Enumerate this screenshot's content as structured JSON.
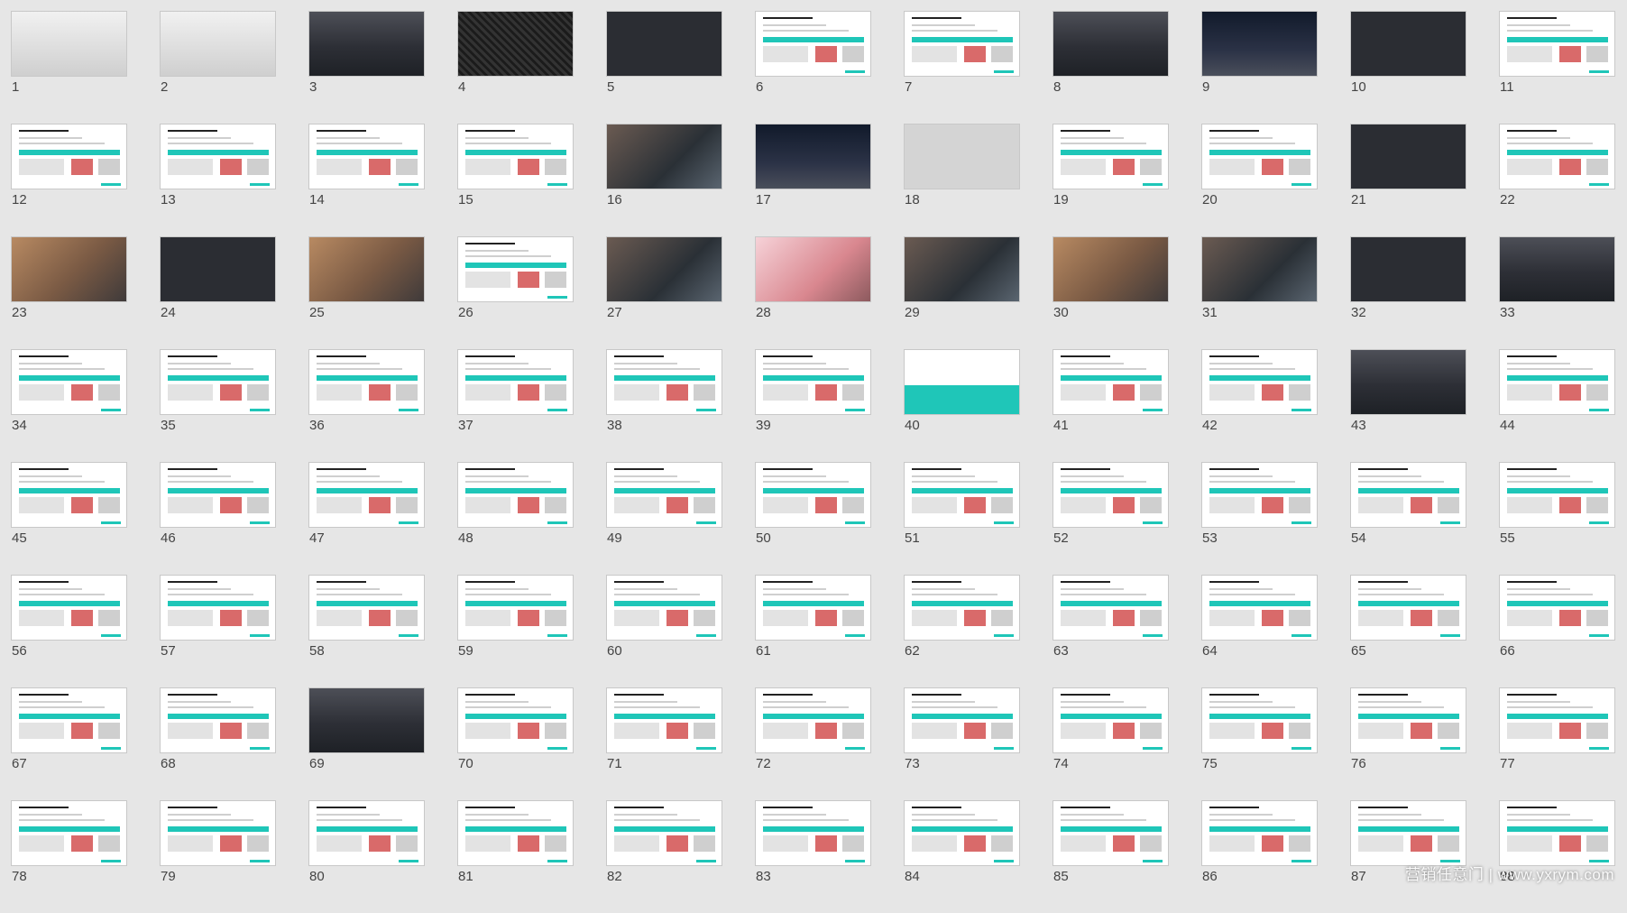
{
  "slides": [
    {
      "number": "1",
      "variant": "v-car"
    },
    {
      "number": "2",
      "variant": "v-car"
    },
    {
      "number": "3",
      "variant": "v-city"
    },
    {
      "number": "4",
      "variant": "v-fabric"
    },
    {
      "number": "5",
      "variant": "v-dark"
    },
    {
      "number": "6",
      "variant": "v-white"
    },
    {
      "number": "7",
      "variant": "v-white"
    },
    {
      "number": "8",
      "variant": "v-city"
    },
    {
      "number": "9",
      "variant": "v-sky"
    },
    {
      "number": "10",
      "variant": "v-dark"
    },
    {
      "number": "11",
      "variant": "v-white"
    },
    {
      "number": "12",
      "variant": "v-white"
    },
    {
      "number": "13",
      "variant": "v-white"
    },
    {
      "number": "14",
      "variant": "v-white"
    },
    {
      "number": "15",
      "variant": "v-white"
    },
    {
      "number": "16",
      "variant": "v-photo"
    },
    {
      "number": "17",
      "variant": "v-sky"
    },
    {
      "number": "18",
      "variant": "v-gray"
    },
    {
      "number": "19",
      "variant": "v-white"
    },
    {
      "number": "20",
      "variant": "v-white"
    },
    {
      "number": "21",
      "variant": "v-dark"
    },
    {
      "number": "22",
      "variant": "v-white"
    },
    {
      "number": "23",
      "variant": "v-warm"
    },
    {
      "number": "24",
      "variant": "v-dark"
    },
    {
      "number": "25",
      "variant": "v-warm"
    },
    {
      "number": "26",
      "variant": "v-white"
    },
    {
      "number": "27",
      "variant": "v-photo"
    },
    {
      "number": "28",
      "variant": "v-pink"
    },
    {
      "number": "29",
      "variant": "v-photo"
    },
    {
      "number": "30",
      "variant": "v-warm"
    },
    {
      "number": "31",
      "variant": "v-photo"
    },
    {
      "number": "32",
      "variant": "v-dark"
    },
    {
      "number": "33",
      "variant": "v-city"
    },
    {
      "number": "34",
      "variant": "v-white"
    },
    {
      "number": "35",
      "variant": "v-white"
    },
    {
      "number": "36",
      "variant": "v-white"
    },
    {
      "number": "37",
      "variant": "v-white"
    },
    {
      "number": "38",
      "variant": "v-white"
    },
    {
      "number": "39",
      "variant": "v-white"
    },
    {
      "number": "40",
      "variant": "v-teal"
    },
    {
      "number": "41",
      "variant": "v-white"
    },
    {
      "number": "42",
      "variant": "v-white"
    },
    {
      "number": "43",
      "variant": "v-city"
    },
    {
      "number": "44",
      "variant": "v-white"
    },
    {
      "number": "45",
      "variant": "v-white"
    },
    {
      "number": "46",
      "variant": "v-white"
    },
    {
      "number": "47",
      "variant": "v-white"
    },
    {
      "number": "48",
      "variant": "v-white"
    },
    {
      "number": "49",
      "variant": "v-white"
    },
    {
      "number": "50",
      "variant": "v-white"
    },
    {
      "number": "51",
      "variant": "v-white"
    },
    {
      "number": "52",
      "variant": "v-white"
    },
    {
      "number": "53",
      "variant": "v-white"
    },
    {
      "number": "54",
      "variant": "v-white"
    },
    {
      "number": "55",
      "variant": "v-white"
    },
    {
      "number": "56",
      "variant": "v-white"
    },
    {
      "number": "57",
      "variant": "v-white"
    },
    {
      "number": "58",
      "variant": "v-white"
    },
    {
      "number": "59",
      "variant": "v-white"
    },
    {
      "number": "60",
      "variant": "v-white"
    },
    {
      "number": "61",
      "variant": "v-white"
    },
    {
      "number": "62",
      "variant": "v-white"
    },
    {
      "number": "63",
      "variant": "v-white"
    },
    {
      "number": "64",
      "variant": "v-white"
    },
    {
      "number": "65",
      "variant": "v-white"
    },
    {
      "number": "66",
      "variant": "v-white"
    },
    {
      "number": "67",
      "variant": "v-white"
    },
    {
      "number": "68",
      "variant": "v-white"
    },
    {
      "number": "69",
      "variant": "v-city"
    },
    {
      "number": "70",
      "variant": "v-white"
    },
    {
      "number": "71",
      "variant": "v-white"
    },
    {
      "number": "72",
      "variant": "v-white"
    },
    {
      "number": "73",
      "variant": "v-white"
    },
    {
      "number": "74",
      "variant": "v-white"
    },
    {
      "number": "75",
      "variant": "v-white"
    },
    {
      "number": "76",
      "variant": "v-white"
    },
    {
      "number": "77",
      "variant": "v-white"
    },
    {
      "number": "78",
      "variant": "v-white"
    },
    {
      "number": "79",
      "variant": "v-white"
    },
    {
      "number": "80",
      "variant": "v-white"
    },
    {
      "number": "81",
      "variant": "v-white"
    },
    {
      "number": "82",
      "variant": "v-white"
    },
    {
      "number": "83",
      "variant": "v-white"
    },
    {
      "number": "84",
      "variant": "v-white"
    },
    {
      "number": "85",
      "variant": "v-white"
    },
    {
      "number": "86",
      "variant": "v-white"
    },
    {
      "number": "87",
      "variant": "v-white"
    },
    {
      "number": "88",
      "variant": "v-white"
    }
  ],
  "watermark": "营销任意门 | www.yxrym.com",
  "colors": {
    "background": "#e6e6e6",
    "accent": "#1fc6b8",
    "number_text": "#444444"
  }
}
